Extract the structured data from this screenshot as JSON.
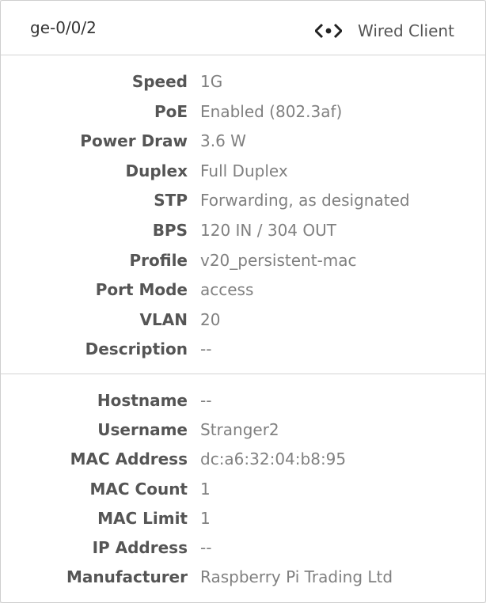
{
  "header": {
    "port_name": "ge-0/0/2",
    "client_type": "Wired Client",
    "client_icon": "wired-client-icon"
  },
  "port_details": [
    {
      "label": "Speed",
      "value": "1G"
    },
    {
      "label": "PoE",
      "value": "Enabled (802.3af)"
    },
    {
      "label": "Power Draw",
      "value": "3.6 W"
    },
    {
      "label": "Duplex",
      "value": "Full Duplex"
    },
    {
      "label": "STP",
      "value": "Forwarding, as designated"
    },
    {
      "label": "BPS",
      "value": "120 IN / 304 OUT"
    },
    {
      "label": "Profile",
      "value": "v20_persistent-mac"
    },
    {
      "label": "Port Mode",
      "value": "access"
    },
    {
      "label": "VLAN",
      "value": "20"
    },
    {
      "label": "Description",
      "value": "--"
    }
  ],
  "client_details": [
    {
      "label": "Hostname",
      "value": "--"
    },
    {
      "label": "Username",
      "value": "Stranger2"
    },
    {
      "label": "MAC Address",
      "value": "dc:a6:32:04:b8:95"
    },
    {
      "label": "MAC Count",
      "value": "1"
    },
    {
      "label": "MAC Limit",
      "value": "1"
    },
    {
      "label": "IP Address",
      "value": "--"
    },
    {
      "label": "Manufacturer",
      "value": "Raspberry Pi Trading Ltd"
    }
  ],
  "colors": {
    "label": "#555555",
    "value": "#808080",
    "divider": "#d4d4d4"
  }
}
